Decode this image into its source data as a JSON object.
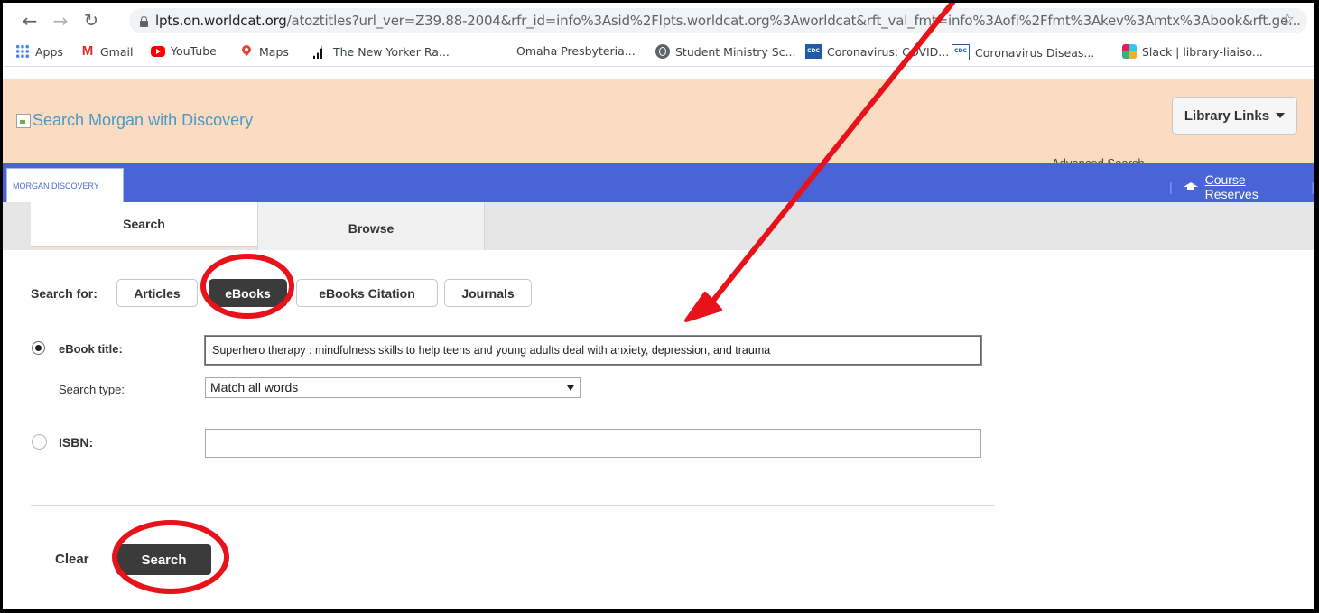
{
  "browser": {
    "url_host": "lpts.on.worldcat.org",
    "url_path": "/atoztitles?url_ver=Z39.88-2004&rfr_id=info%3Asid%2Flpts.worldcat.org%3Aworldcat&rft_val_fmt=info%3Aofi%2Ffmt%3Akev%3Amtx%3Abook&rft.ge...",
    "bookmarks": [
      {
        "label": "Apps",
        "icon": "apps-icon"
      },
      {
        "label": "Gmail",
        "icon": "gmail-icon"
      },
      {
        "label": "YouTube",
        "icon": "youtube-icon"
      },
      {
        "label": "Maps",
        "icon": "maps-icon"
      },
      {
        "label": "The New Yorker Ra...",
        "icon": "new-yorker-icon"
      },
      {
        "label": "Omaha Presbyteria...",
        "icon": ""
      },
      {
        "label": "Student Ministry Sc...",
        "icon": "globe-icon"
      },
      {
        "label": "Coronavirus: COVID...",
        "icon": "cdc-icon"
      },
      {
        "label": "Coronavirus Diseas...",
        "icon": "cdc-icon"
      },
      {
        "label": "Slack | library-liaiso...",
        "icon": "slack-icon"
      }
    ]
  },
  "header": {
    "logo_alt": "Search Morgan with Discovery",
    "library_links": "Library Links",
    "advanced_search_fragment": "Advanced Search"
  },
  "nav": {
    "morgan_tab": "MORGAN DISCOVERY",
    "course_reserves": "Course Reserves"
  },
  "tabs": {
    "search": "Search",
    "browse": "Browse"
  },
  "form": {
    "search_for_label": "Search for:",
    "types": [
      "Articles",
      "eBooks",
      "eBooks Citation",
      "Journals"
    ],
    "active_type": "eBooks",
    "ebook_title_label": "eBook title:",
    "ebook_title_value": "Superhero therapy : mindfulness skills to help teens and young adults deal with anxiety, depression, and trauma",
    "search_type_label": "Search type:",
    "search_type_value": "Match all words",
    "isbn_label": "ISBN:",
    "isbn_value": "",
    "clear_label": "Clear",
    "search_label": "Search"
  },
  "annotation_colors": {
    "highlight": "#e8121a"
  }
}
